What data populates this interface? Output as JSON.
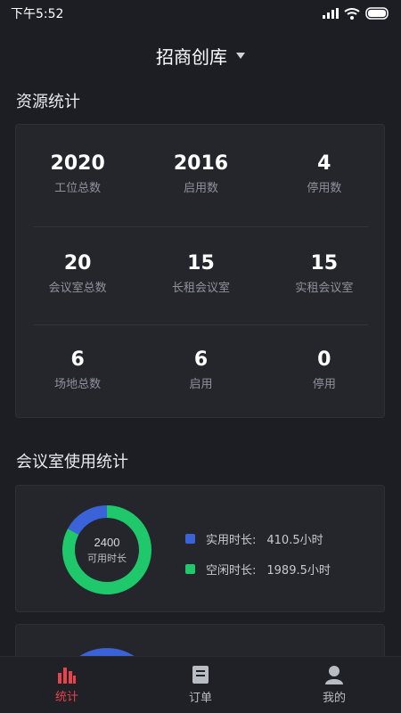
{
  "status_bar": {
    "time": "下午5:52"
  },
  "header": {
    "title": "招商创库"
  },
  "resource_stats": {
    "section_title": "资源统计",
    "rows": [
      [
        {
          "value": "2020",
          "label": "工位总数"
        },
        {
          "value": "2016",
          "label": "启用数"
        },
        {
          "value": "4",
          "label": "停用数"
        }
      ],
      [
        {
          "value": "20",
          "label": "会议室总数"
        },
        {
          "value": "15",
          "label": "长租会议室"
        },
        {
          "value": "15",
          "label": "实租会议室"
        }
      ],
      [
        {
          "value": "6",
          "label": "场地总数"
        },
        {
          "value": "6",
          "label": "启用"
        },
        {
          "value": "0",
          "label": "停用"
        }
      ]
    ]
  },
  "meeting_room_stats": {
    "section_title": "会议室使用统计",
    "center_value": "2400",
    "center_label": "可用时长",
    "legend": [
      {
        "name": "实用时长:",
        "value": "410.5小时",
        "color": "#3a63d9"
      },
      {
        "name": "空闲时长:",
        "value": "1989.5小时",
        "color": "#1fc86b"
      }
    ]
  },
  "chart_data": {
    "type": "pie",
    "title": "",
    "categories": [
      "实用时长",
      "空闲时长"
    ],
    "values": [
      410.5,
      1989.5
    ],
    "total": 2400,
    "colors": [
      "#3a63d9",
      "#1fc86b"
    ]
  },
  "tab_bar": {
    "tabs": [
      {
        "label": "统计",
        "icon": "bar-chart-icon",
        "active": true
      },
      {
        "label": "订单",
        "icon": "document-icon",
        "active": false
      },
      {
        "label": "我的",
        "icon": "user-icon",
        "active": false
      }
    ]
  }
}
